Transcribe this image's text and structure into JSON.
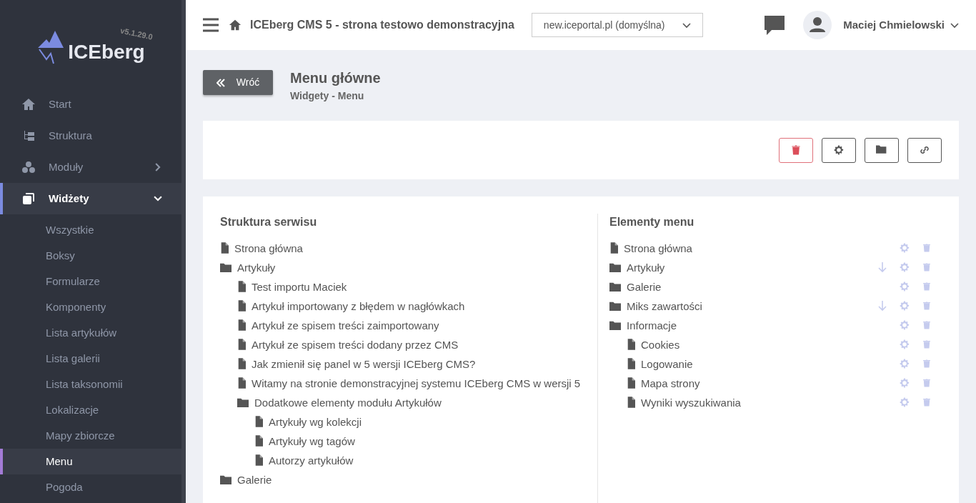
{
  "sidebar": {
    "logo": "ICEberg",
    "version": "v5.1.29.0",
    "items": [
      {
        "label": "Start",
        "selected": false
      },
      {
        "label": "Struktura",
        "selected": false
      },
      {
        "label": "Moduły",
        "selected": false,
        "expanded": false
      },
      {
        "label": "Widżety",
        "selected": true,
        "expanded": true,
        "children": [
          {
            "label": "Wszystkie",
            "selected": false
          },
          {
            "label": "Boksy",
            "selected": false
          },
          {
            "label": "Formularze",
            "selected": false
          },
          {
            "label": "Komponenty",
            "selected": false
          },
          {
            "label": "Lista artykułów",
            "selected": false
          },
          {
            "label": "Lista galerii",
            "selected": false
          },
          {
            "label": "Lista taksonomii",
            "selected": false
          },
          {
            "label": "Lokalizacje",
            "selected": false
          },
          {
            "label": "Mapy zbiorcze",
            "selected": false
          },
          {
            "label": "Menu",
            "selected": true
          },
          {
            "label": "Pogoda",
            "selected": false
          }
        ]
      }
    ]
  },
  "topbar": {
    "title": "ICEberg CMS 5 - strona testowo demonstracyjna",
    "site_select": "new.iceportal.pl (domyślna)",
    "user": "Maciej Chmielowski"
  },
  "header": {
    "back": "Wróć",
    "title": "Menu główne",
    "subtitle": "Widgety - Menu"
  },
  "structure": {
    "title": "Struktura serwisu",
    "items": [
      {
        "label": "Strona główna",
        "kind": "page"
      },
      {
        "label": "Artykuły",
        "kind": "folder",
        "children": [
          {
            "label": "Test importu Maciek",
            "kind": "page"
          },
          {
            "label": "Artykuł importowany z błędem w nagłówkach",
            "kind": "page"
          },
          {
            "label": "Artykuł ze spisem treści zaimportowany",
            "kind": "page"
          },
          {
            "label": "Artykuł ze spisem treści dodany przez CMS",
            "kind": "page"
          },
          {
            "label": "Jak zmienił się panel w 5 wersji ICEberg CMS?",
            "kind": "page"
          },
          {
            "label": "Witamy na stronie demonstracyjnej systemu ICEberg CMS w wersji 5",
            "kind": "page"
          },
          {
            "label": "Dodatkowe elementy modułu Artykułów",
            "kind": "folder",
            "children": [
              {
                "label": "Artykuły wg kolekcji",
                "kind": "page"
              },
              {
                "label": "Artykuły wg tagów",
                "kind": "page"
              },
              {
                "label": "Autorzy artykułów",
                "kind": "page"
              }
            ]
          }
        ]
      },
      {
        "label": "Galerie",
        "kind": "folder"
      }
    ]
  },
  "menu": {
    "title": "Elementy menu",
    "items": [
      {
        "label": "Strona główna",
        "kind": "page",
        "movable_down": false
      },
      {
        "label": "Artykuły",
        "kind": "folder",
        "movable_down": true
      },
      {
        "label": "Galerie",
        "kind": "folder",
        "movable_down": false
      },
      {
        "label": "Miks zawartości",
        "kind": "folder",
        "movable_down": true
      },
      {
        "label": "Informacje",
        "kind": "folder",
        "movable_down": false,
        "children": [
          {
            "label": "Cookies",
            "kind": "page",
            "movable_down": false
          },
          {
            "label": "Logowanie",
            "kind": "page",
            "movable_down": false
          },
          {
            "label": "Mapa strony",
            "kind": "page",
            "movable_down": false
          },
          {
            "label": "Wyniki wyszukiwania",
            "kind": "page",
            "movable_down": false
          }
        ]
      }
    ]
  }
}
